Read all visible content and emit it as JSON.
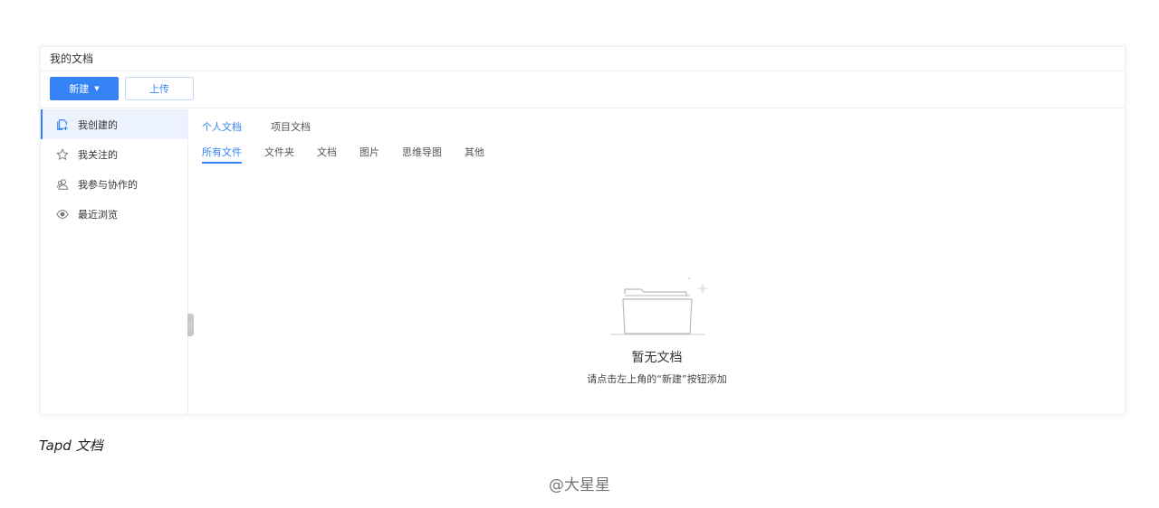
{
  "window": {
    "title": "我的文档"
  },
  "toolbar": {
    "new_label": "新建",
    "upload_label": "上传"
  },
  "sidebar": {
    "items": [
      {
        "label": "我创建的",
        "icon": "create-doc-icon",
        "active": true
      },
      {
        "label": "我关注的",
        "icon": "star-icon",
        "active": false
      },
      {
        "label": "我参与协作的",
        "icon": "collaborate-icon",
        "active": false
      },
      {
        "label": "最近浏览",
        "icon": "eye-icon",
        "active": false
      }
    ]
  },
  "tabs": {
    "top": [
      {
        "label": "个人文档",
        "active": true
      },
      {
        "label": "项目文档",
        "active": false
      }
    ],
    "sub": [
      {
        "label": "所有文件",
        "active": true
      },
      {
        "label": "文件夹",
        "active": false
      },
      {
        "label": "文档",
        "active": false
      },
      {
        "label": "图片",
        "active": false
      },
      {
        "label": "思维导图",
        "active": false
      },
      {
        "label": "其他",
        "active": false
      }
    ]
  },
  "empty": {
    "title": "暂无文档",
    "description": "请点击左上角的“新建”按钮添加",
    "icon": "empty-folder-icon"
  },
  "caption": "Tapd 文档",
  "watermark": "@大星星",
  "colors": {
    "accent": "#3582f8",
    "active_bg": "#edf3fe"
  }
}
